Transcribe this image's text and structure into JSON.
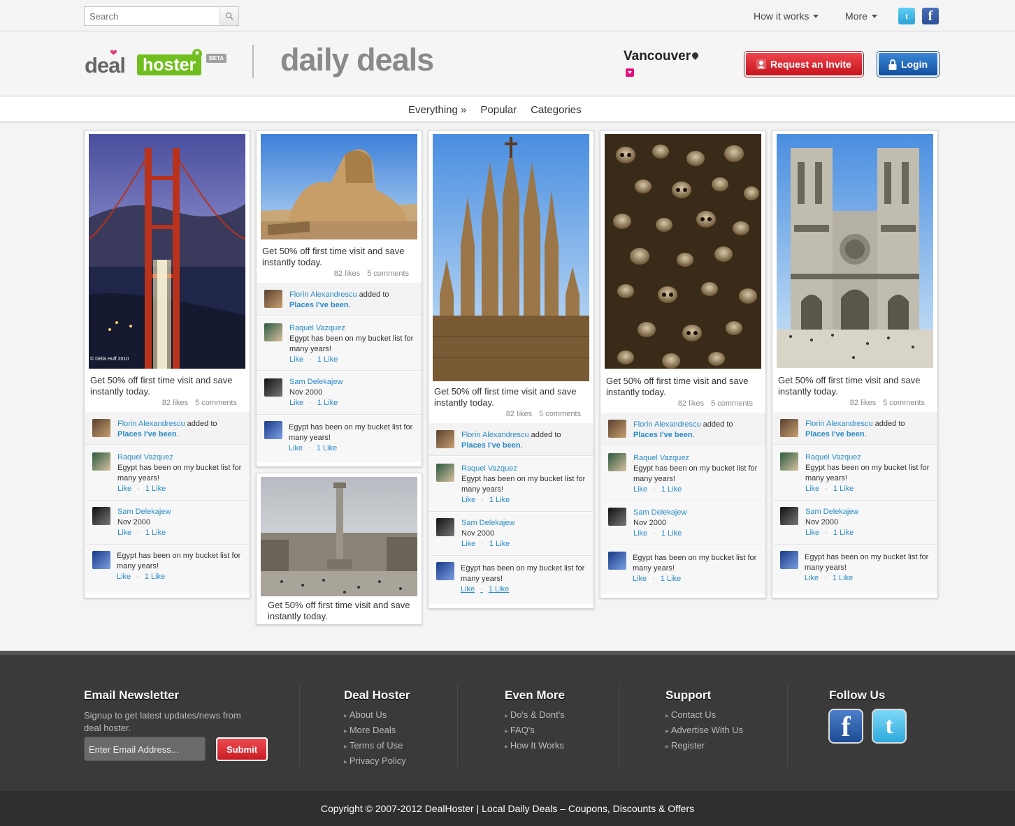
{
  "topbar": {
    "search_placeholder": "Search",
    "nav_how": "How it works",
    "nav_more": "More",
    "twitter_glyph": "t",
    "facebook_glyph": "f"
  },
  "header": {
    "logo_deal": "deal",
    "logo_hoster": "hoster",
    "logo_beta": "BETA",
    "tagline": "daily deals",
    "city": "Vancouver",
    "invite_label": "Request an Invite",
    "login_label": "Login"
  },
  "nav": {
    "everything": "Everything »",
    "popular": "Popular",
    "categories": "Categories"
  },
  "card_common": {
    "title": "Get 50% off first time visit and save instantly today.",
    "likes": "82 likes",
    "comments": "5 comments",
    "user1": "Florin Alexandrescu",
    "added_to": "added to",
    "places": "Places I've been",
    "period": ".",
    "user2": "Raquel Vazquez",
    "msg": "Egypt has been on my bucket list for many years!",
    "user3": "Sam Delekajew",
    "date": "Nov 2000",
    "like": "Like",
    "sep": "·",
    "one_like": "1 Like",
    "photo_credit": "© Della Huff 2010"
  },
  "footer": {
    "newsletter_head": "Email Newsletter",
    "newsletter_text": "Signup to get latest updates/news from deal hoster.",
    "email_placeholder": "Enter Email Address...",
    "submit": "Submit",
    "col2_head": "Deal Hoster",
    "col2": [
      "About Us",
      "More Deals",
      "Terms of Use",
      "Privacy Policy"
    ],
    "col3_head": "Even More",
    "col3": [
      "Do's & Dont's",
      "FAQ's",
      "How It Works"
    ],
    "col4_head": "Support",
    "col4": [
      "Contact Us",
      "Advertise With Us",
      "Register"
    ],
    "col5_head": "Follow Us",
    "fb_glyph": "f",
    "tw_glyph": "t",
    "copyright": "Copyright © 2007-2012 DealHoster | Local Daily Deals – Coupons, Discounts & Offers"
  },
  "colors": {
    "accent_green": "#70bf1e",
    "link_blue": "#2a8bc9",
    "invite_red": "#d52a33",
    "login_blue": "#2469bc"
  }
}
